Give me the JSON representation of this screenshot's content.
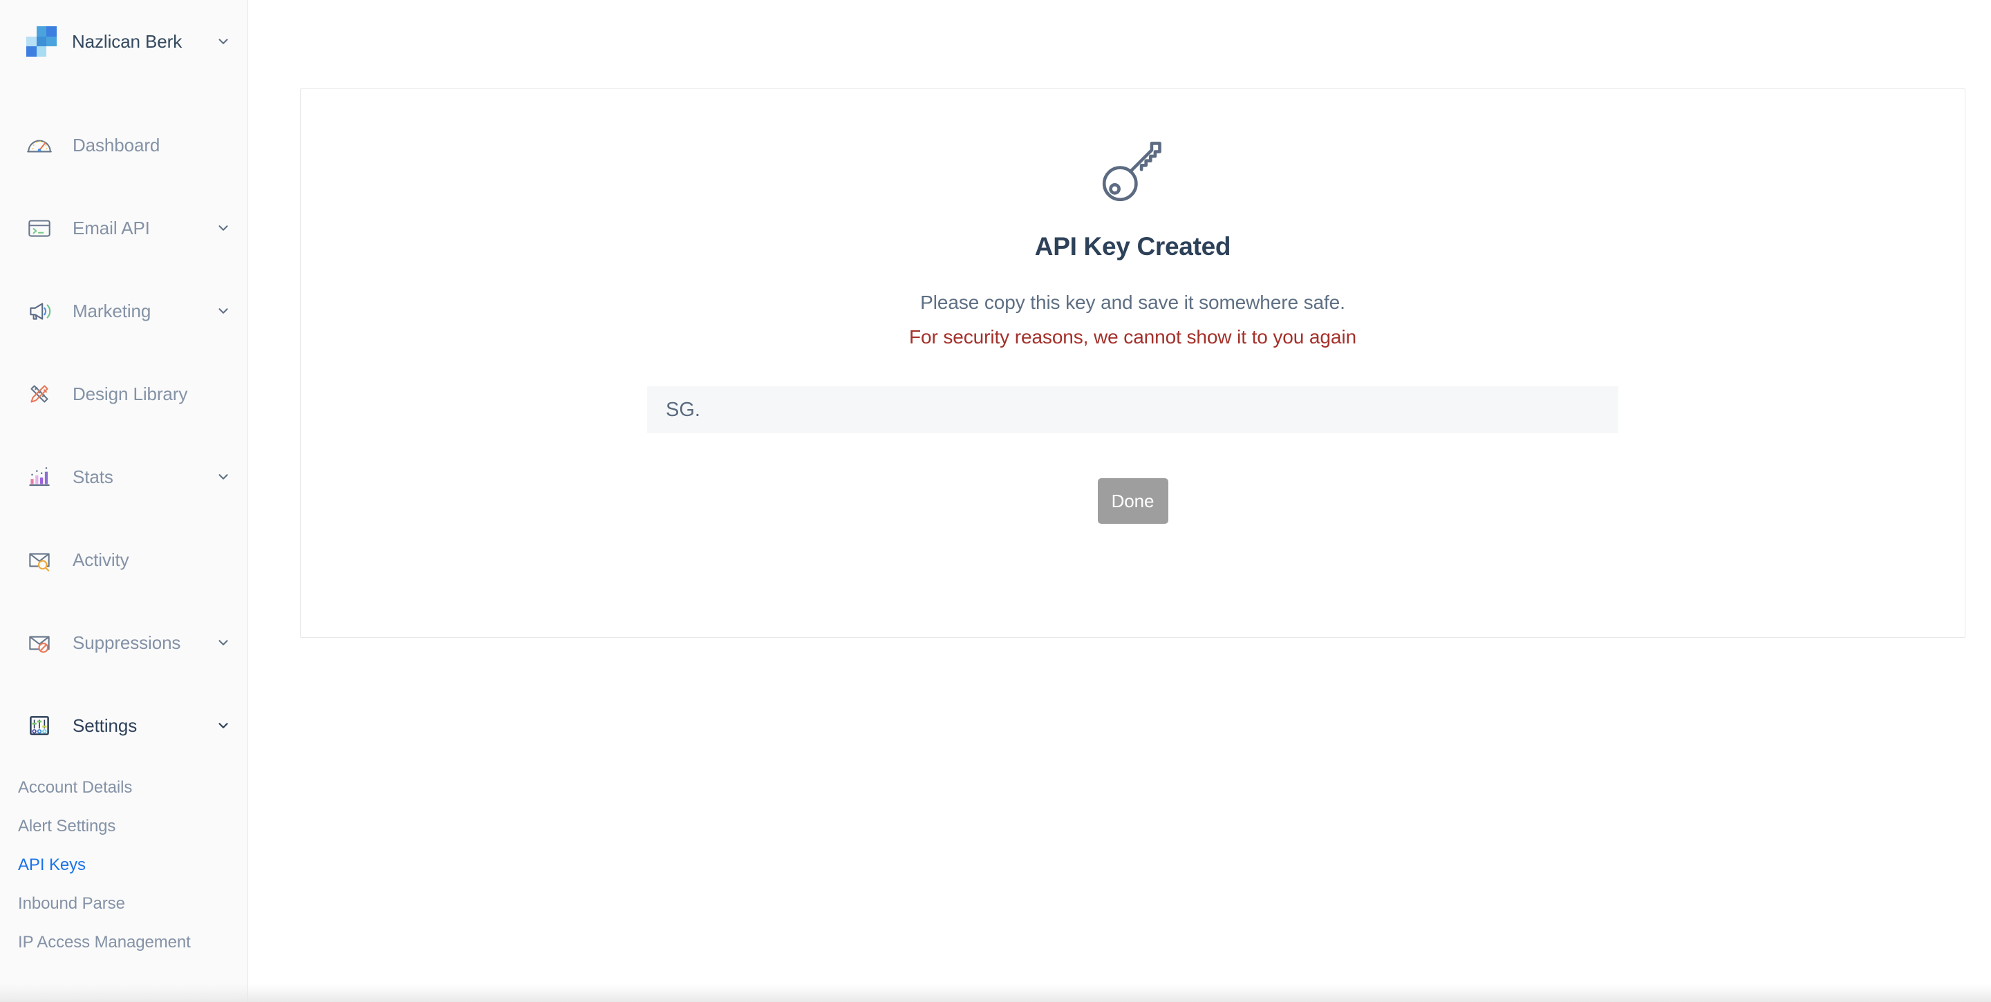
{
  "brand": {
    "name": "Nazlican Berk",
    "logo_colors": [
      "#b7dff5",
      "#4ba3dd",
      "#3d7fe0",
      "#3d8fd6",
      "#a8dcf2"
    ],
    "caret_icon": "chevron-down-icon"
  },
  "sidebar": {
    "items": [
      {
        "label": "Dashboard",
        "icon": "speedometer-icon",
        "expandable": false,
        "active": false
      },
      {
        "label": "Email API",
        "icon": "terminal-card-icon",
        "expandable": true,
        "active": false
      },
      {
        "label": "Marketing",
        "icon": "megaphone-icon",
        "expandable": true,
        "active": false
      },
      {
        "label": "Design Library",
        "icon": "ruler-pencil-icon",
        "expandable": false,
        "active": false
      },
      {
        "label": "Stats",
        "icon": "bar-chart-icon",
        "expandable": true,
        "active": false
      },
      {
        "label": "Activity",
        "icon": "envelope-search-icon",
        "expandable": false,
        "active": false
      },
      {
        "label": "Suppressions",
        "icon": "envelope-blocked-icon",
        "expandable": true,
        "active": false
      },
      {
        "label": "Settings",
        "icon": "sliders-icon",
        "expandable": true,
        "active": true
      }
    ],
    "subnav": [
      {
        "label": "Account Details",
        "active": false
      },
      {
        "label": "Alert Settings",
        "active": false
      },
      {
        "label": "API Keys",
        "active": true
      },
      {
        "label": "Inbound Parse",
        "active": false
      },
      {
        "label": "IP Access Management",
        "active": false
      }
    ],
    "active_link_color": "#1a73e8"
  },
  "main": {
    "illustration_icon": "key-icon",
    "title": "API Key Created",
    "subtitle": "Please copy this key and save it somewhere safe.",
    "warning": "For security reasons, we cannot show it to you again",
    "warning_color": "#a4302a",
    "api_key_value": "SG.",
    "done_label": "Done",
    "done_button_color": "#9e9e9e"
  }
}
